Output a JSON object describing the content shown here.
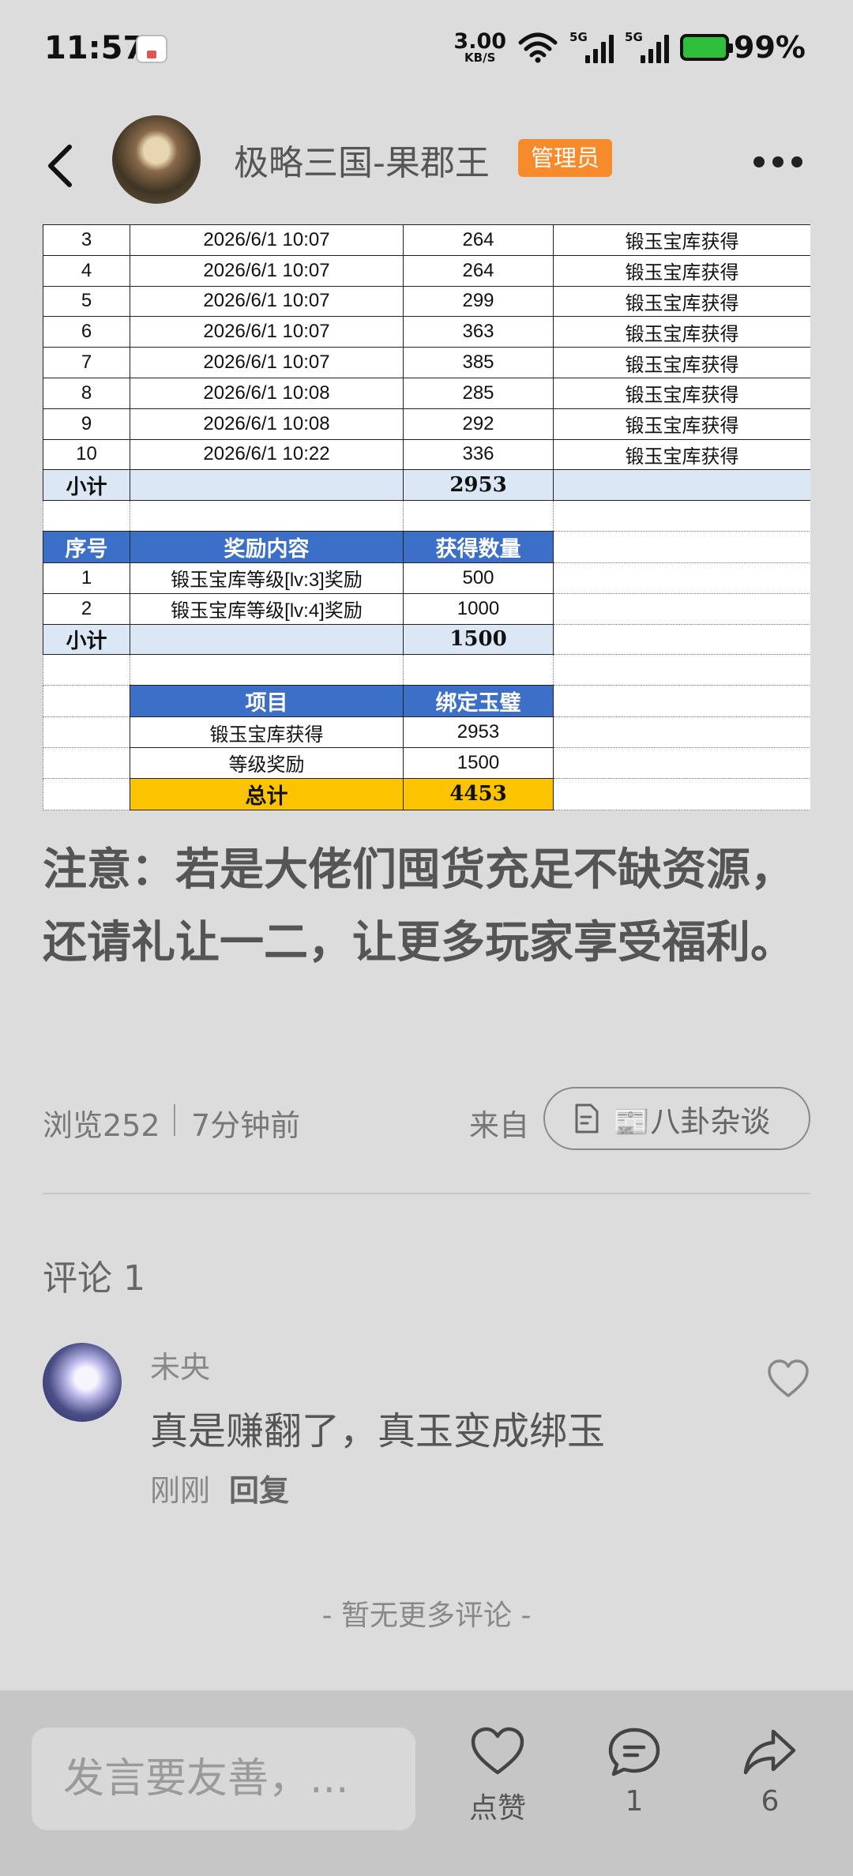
{
  "status_bar": {
    "time": "11:57",
    "net_speed_value": "3.00",
    "net_speed_unit": "KB/S",
    "signal1_tag": "5G",
    "signal2_tag": "5G",
    "battery": "99%",
    "battery_color": "#2fbf3b",
    "icons": [
      "notification-icon",
      "wifi-icon",
      "signal-icon",
      "battery-icon"
    ]
  },
  "header": {
    "title": "极略三国-果郡王",
    "badge": "管理员",
    "badge_color": "#f78a2a"
  },
  "sheet": {
    "rows1": [
      {
        "no": "3",
        "time": "2026/6/1 10:07",
        "amount": "264",
        "source": "锻玉宝库获得"
      },
      {
        "no": "4",
        "time": "2026/6/1 10:07",
        "amount": "264",
        "source": "锻玉宝库获得"
      },
      {
        "no": "5",
        "time": "2026/6/1 10:07",
        "amount": "299",
        "source": "锻玉宝库获得"
      },
      {
        "no": "6",
        "time": "2026/6/1 10:07",
        "amount": "363",
        "source": "锻玉宝库获得"
      },
      {
        "no": "7",
        "time": "2026/6/1 10:07",
        "amount": "385",
        "source": "锻玉宝库获得"
      },
      {
        "no": "8",
        "time": "2026/6/1 10:08",
        "amount": "285",
        "source": "锻玉宝库获得"
      },
      {
        "no": "9",
        "time": "2026/6/1 10:08",
        "amount": "292",
        "source": "锻玉宝库获得"
      },
      {
        "no": "10",
        "time": "2026/6/1 10:22",
        "amount": "336",
        "source": "锻玉宝库获得"
      }
    ],
    "subtotal1_label": "小计",
    "subtotal1_value": "2953",
    "reward_headers": [
      "序号",
      "奖励内容",
      "获得数量"
    ],
    "reward_rows": [
      {
        "no": "1",
        "content": "锻玉宝库等级[lv:3]奖励",
        "amount": "500"
      },
      {
        "no": "2",
        "content": "锻玉宝库等级[lv:4]奖励",
        "amount": "1000"
      }
    ],
    "subtotal2_label": "小计",
    "subtotal2_value": "1500",
    "summary_headers": [
      "项目",
      "绑定玉璧"
    ],
    "summary_rows": [
      {
        "item": "锻玉宝库获得",
        "value": "2953"
      },
      {
        "item": "等级奖励",
        "value": "1500"
      }
    ],
    "total_label": "总计",
    "total_value": "4453",
    "colors": {
      "header": "#3c6fc7",
      "subtotal": "#dbe7f5",
      "total": "#fcc300"
    }
  },
  "notice": "注意：若是大佬们囤货充足不缺资源，还请礼让一二，让更多玩家享受福利。",
  "meta": {
    "views": "浏览252",
    "time_ago": "7分钟前",
    "from_label": "来自",
    "source": "📰八卦杂谈"
  },
  "comments": {
    "title": "评论 1",
    "items": [
      {
        "name": "未央",
        "text": "真是赚翻了，真玉变成绑玉",
        "time": "刚刚",
        "reply": "回复"
      }
    ],
    "no_more": "- 暂无更多评论 -"
  },
  "bottom_bar": {
    "input_placeholder": "发言要友善，...",
    "like_label": "点赞",
    "comment_count": "1",
    "share_count": "6"
  }
}
